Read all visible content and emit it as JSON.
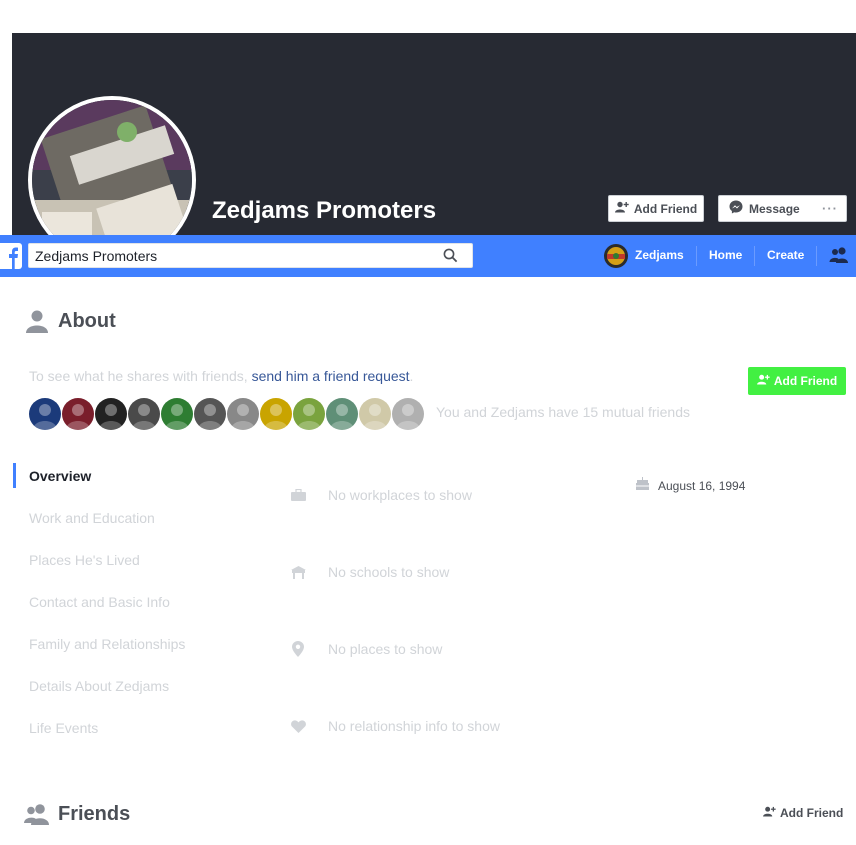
{
  "profile": {
    "name": "Zedjams Promoters",
    "cover_buttons": {
      "add_friend": "Add Friend",
      "message": "Message",
      "more": "···"
    }
  },
  "topbar": {
    "search_value": "Zedjams Promoters",
    "user_name": "Zedjams",
    "nav": [
      "Home",
      "Create"
    ],
    "accent": "#4080ff"
  },
  "about": {
    "title": "About",
    "share_prefix": "To see what he shares with friends, ",
    "share_link": "send him a friend request",
    "share_suffix": ".",
    "add_friend": "Add Friend",
    "mutual_text": "You and Zedjams have 15 mutual friends",
    "mutual_colors": [
      "#1b3a7a",
      "#7a1e2b",
      "#222222",
      "#4a4a4a",
      "#2e7d32",
      "#555555",
      "#888888",
      "#c9a400",
      "#7aa33e",
      "#5f8f77",
      "#d0c9a8",
      "#b0b0b0"
    ]
  },
  "sidebar": {
    "items": [
      "Overview",
      "Work and Education",
      "Places He's Lived",
      "Contact and Basic Info",
      "Family and Relationships",
      "Details About Zedjams",
      "Life Events"
    ]
  },
  "overview": {
    "work": "No workplaces to show",
    "schools": "No schools to show",
    "places": "No places to show",
    "relationship": "No relationship info to show",
    "birthday": "August 16, 1994"
  },
  "friends": {
    "title": "Friends",
    "add_friend": "Add Friend"
  }
}
